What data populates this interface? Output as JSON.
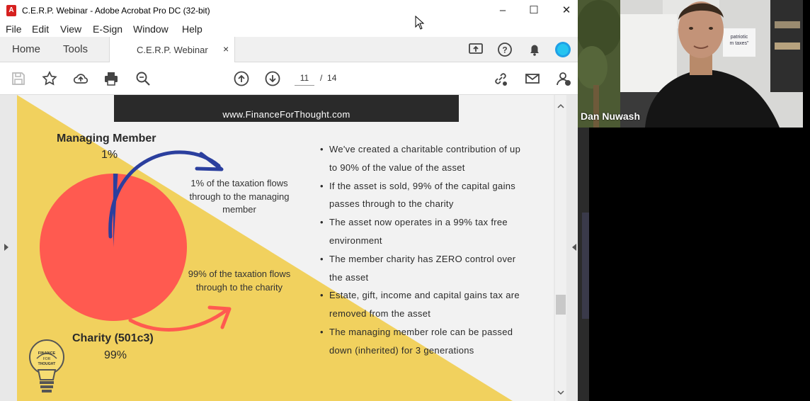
{
  "window": {
    "title": "C.E.R.P. Webinar - Adobe Acrobat Pro DC (32-bit)",
    "minimize": "–",
    "maximize": "☐",
    "close": "✕"
  },
  "menu": [
    "File",
    "Edit",
    "View",
    "E-Sign",
    "Window",
    "Help"
  ],
  "tabs": {
    "home": "Home",
    "tools": "Tools",
    "document": "C.E.R.P. Webinar",
    "close": "×"
  },
  "toolbar": {
    "current_page": "11",
    "separator": "/",
    "total_pages": "14"
  },
  "slide": {
    "banner": "www.FinanceForThought.com",
    "managing_member": {
      "label": "Managing Member",
      "pct": "1%",
      "note": "1% of the taxation flows through to the managing member"
    },
    "charity": {
      "label": "Charity (501c3)",
      "pct": "99%",
      "note": "99% of the taxation flows through to the charity"
    },
    "pie": {
      "slices": [
        {
          "name": "Managing Member",
          "value": 1,
          "color": "#2b3f9e"
        },
        {
          "name": "Charity (501c3)",
          "value": 99,
          "color": "#ff5a50"
        }
      ]
    },
    "logo_text": "FINANCE FOR THOUGHT",
    "bullets": [
      "We've created a charitable contribution of up to 90% of the value of the asset",
      "If the asset is sold, 99% of the capital gains passes through to the charity",
      "The asset now operates in a 99% tax free environment",
      "The member charity has ZERO control over the asset",
      "Estate, gift, income and capital gains tax are removed from the asset",
      "The managing member role can be passed down (inherited) for 3 generations"
    ],
    "colors": {
      "yellow": "#f1d15e",
      "coral": "#ff5a50",
      "navy": "#2b3f9e",
      "banner": "#2a2a2a"
    }
  },
  "video": {
    "presenter": "Dan Nuwash",
    "poster_text": "patriotic ... m taxes"
  }
}
